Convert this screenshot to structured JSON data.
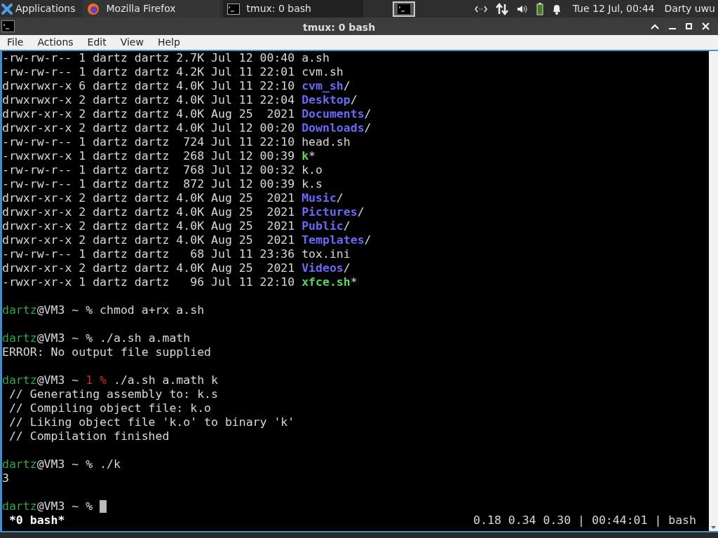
{
  "panel": {
    "apps_menu": "Applications",
    "tasks": [
      {
        "label": "Mozilla Firefox",
        "selected": false
      },
      {
        "label": "tmux: 0 bash",
        "selected": true
      }
    ],
    "clock": "Tue 12 Jul, 00:44",
    "user": "Darty uwu"
  },
  "window": {
    "title": "tmux: 0 bash"
  },
  "menu": [
    "File",
    "Actions",
    "Edit",
    "View",
    "Help"
  ],
  "terminal": [
    {
      "kind": "ls_file",
      "text": "-rw-rw-r-- 1 dartz dartz 2.7K Jul 12 00:40 ",
      "name": "a.sh"
    },
    {
      "kind": "ls_file",
      "text": "-rw-rw-r-- 1 dartz dartz 4.2K Jul 11 22:01 ",
      "name": "cvm.sh"
    },
    {
      "kind": "ls_dir",
      "text": "drwxrwxr-x 6 dartz dartz 4.0K Jul 11 22:10 ",
      "name": "cvm_sh",
      "suffix": "/"
    },
    {
      "kind": "ls_dir",
      "text": "drwxrwxr-x 2 dartz dartz 4.0K Jul 11 22:04 ",
      "name": "Desktop",
      "suffix": "/"
    },
    {
      "kind": "ls_dir",
      "text": "drwxr-xr-x 2 dartz dartz 4.0K Aug 25  2021 ",
      "name": "Documents",
      "suffix": "/"
    },
    {
      "kind": "ls_dir",
      "text": "drwxr-xr-x 2 dartz dartz 4.0K Jul 12 00:20 ",
      "name": "Downloads",
      "suffix": "/"
    },
    {
      "kind": "ls_file",
      "text": "-rw-rw-r-- 1 dartz dartz  724 Jul 11 22:10 ",
      "name": "head.sh"
    },
    {
      "kind": "ls_exec",
      "text": "-rwxrwxr-x 1 dartz dartz  268 Jul 12 00:39 ",
      "name": "k",
      "suffix": "*"
    },
    {
      "kind": "ls_file",
      "text": "-rw-rw-r-- 1 dartz dartz  768 Jul 12 00:32 ",
      "name": "k.o"
    },
    {
      "kind": "ls_file",
      "text": "-rw-rw-r-- 1 dartz dartz  872 Jul 12 00:39 ",
      "name": "k.s"
    },
    {
      "kind": "ls_dir",
      "text": "drwxr-xr-x 2 dartz dartz 4.0K Aug 25  2021 ",
      "name": "Music",
      "suffix": "/"
    },
    {
      "kind": "ls_dir",
      "text": "drwxr-xr-x 2 dartz dartz 4.0K Aug 25  2021 ",
      "name": "Pictures",
      "suffix": "/"
    },
    {
      "kind": "ls_dir",
      "text": "drwxr-xr-x 2 dartz dartz 4.0K Aug 25  2021 ",
      "name": "Public",
      "suffix": "/"
    },
    {
      "kind": "ls_dir",
      "text": "drwxr-xr-x 2 dartz dartz 4.0K Aug 25  2021 ",
      "name": "Templates",
      "suffix": "/"
    },
    {
      "kind": "ls_file",
      "text": "-rw-rw-r-- 1 dartz dartz   68 Jul 11 23:36 ",
      "name": "tox.ini"
    },
    {
      "kind": "ls_dir",
      "text": "drwxr-xr-x 2 dartz dartz 4.0K Aug 25  2021 ",
      "name": "Videos",
      "suffix": "/"
    },
    {
      "kind": "ls_exec",
      "text": "-rwxr-xr-x 1 dartz dartz   96 Jul 11 22:10 ",
      "name": "xfce.sh",
      "suffix": "*"
    },
    {
      "kind": "blank"
    },
    {
      "kind": "prompt",
      "user": "dartz",
      "host": "@VM3 ~",
      "sign": "%",
      "command": "chmod a+rx a.sh"
    },
    {
      "kind": "blank"
    },
    {
      "kind": "prompt",
      "user": "dartz",
      "host": "@VM3 ~",
      "sign": "%",
      "command": "./a.sh a.math"
    },
    {
      "kind": "output",
      "text": "ERROR: No output file supplied"
    },
    {
      "kind": "blank"
    },
    {
      "kind": "prompt",
      "user": "dartz",
      "host": "@VM3 ~",
      "exit_code": "1",
      "sign": "%",
      "command": "./a.sh a.math k"
    },
    {
      "kind": "output",
      "text": " // Generating assembly to: k.s"
    },
    {
      "kind": "output",
      "text": " // Compiling object file: k.o"
    },
    {
      "kind": "output",
      "text": " // Liking object file 'k.o' to binary 'k'"
    },
    {
      "kind": "output",
      "text": " // Compilation finished"
    },
    {
      "kind": "blank"
    },
    {
      "kind": "prompt",
      "user": "dartz",
      "host": "@VM3 ~",
      "sign": "%",
      "command": "./k"
    },
    {
      "kind": "output",
      "text": "3"
    },
    {
      "kind": "blank"
    },
    {
      "kind": "prompt",
      "user": "dartz",
      "host": "@VM3 ~",
      "sign": "%",
      "cursor": true
    }
  ],
  "tmux_status": {
    "window": "*0 bash*",
    "right": "0.18 0.34 0.30 | 00:44:01 | bash"
  }
}
